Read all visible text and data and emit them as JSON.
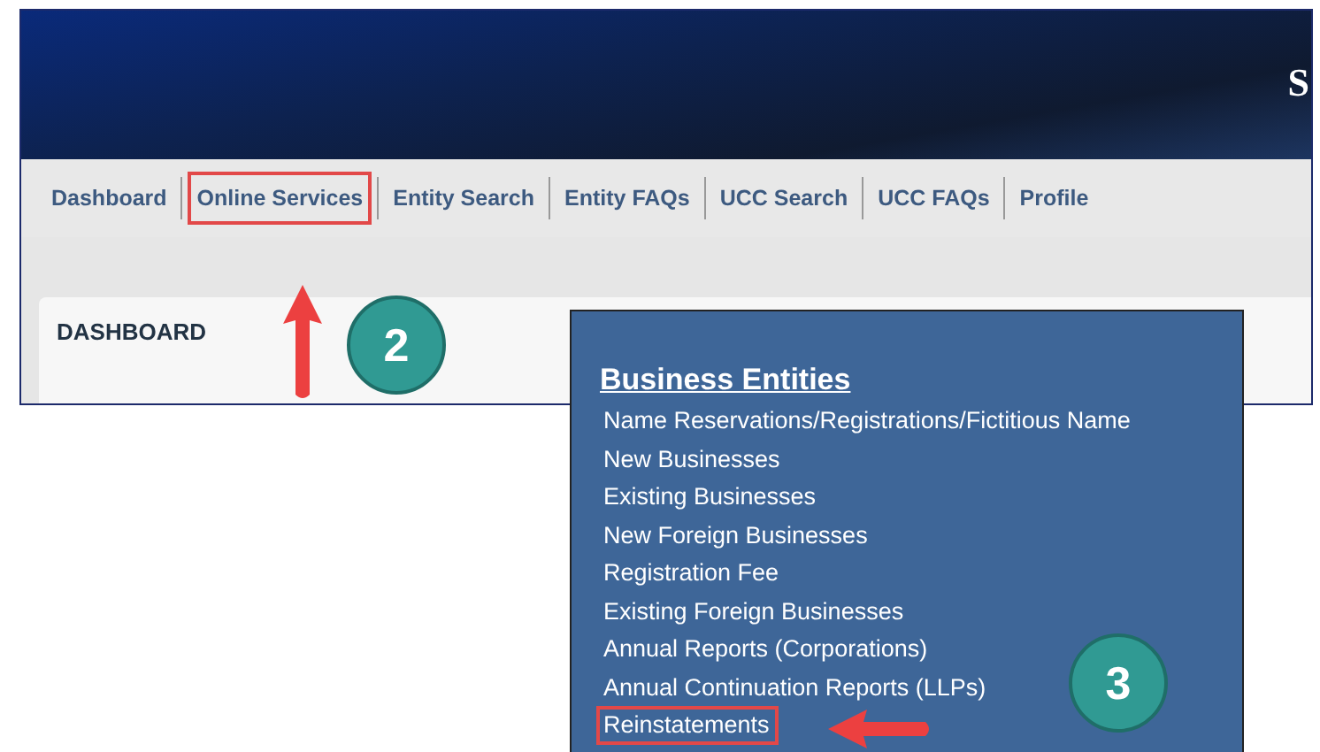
{
  "header": {
    "title_fragment": "S"
  },
  "nav": [
    {
      "label": "Dashboard",
      "highlighted": false
    },
    {
      "label": "Online Services",
      "highlighted": true
    },
    {
      "label": "Entity Search",
      "highlighted": false
    },
    {
      "label": "Entity FAQs",
      "highlighted": false
    },
    {
      "label": "UCC Search",
      "highlighted": false
    },
    {
      "label": "UCC FAQs",
      "highlighted": false
    },
    {
      "label": "Profile",
      "highlighted": false
    }
  ],
  "card": {
    "title": "DASHBOARD"
  },
  "menu": {
    "heading": "Business Entities",
    "items": [
      {
        "label": "Name Reservations/Registrations/Fictitious Name",
        "highlighted": false
      },
      {
        "label": "New Businesses",
        "highlighted": false
      },
      {
        "label": "Existing Businesses",
        "highlighted": false
      },
      {
        "label": "New Foreign Businesses",
        "highlighted": false
      },
      {
        "label": "Registration Fee",
        "highlighted": false
      },
      {
        "label": "Existing Foreign Businesses",
        "highlighted": false
      },
      {
        "label": "Annual Reports (Corporations)",
        "highlighted": false
      },
      {
        "label": "Annual Continuation Reports (LLPs)",
        "highlighted": false
      },
      {
        "label": "Reinstatements",
        "highlighted": true
      }
    ]
  },
  "callouts": [
    {
      "label": "2",
      "kind": "up"
    },
    {
      "label": "3",
      "kind": "left"
    }
  ]
}
